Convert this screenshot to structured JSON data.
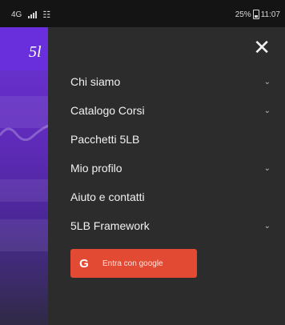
{
  "status_bar": {
    "network": "4G",
    "battery": "25%",
    "time": "11:07"
  },
  "background_page": {
    "logo": "5l"
  },
  "drawer": {
    "close_icon": "close-icon",
    "menu": [
      {
        "label": "Chi siamo",
        "has_submenu": true
      },
      {
        "label": "Catalogo Corsi",
        "has_submenu": true
      },
      {
        "label": "Pacchetti 5LB",
        "has_submenu": false
      },
      {
        "label": "Mio profilo",
        "has_submenu": true
      },
      {
        "label": "Aiuto e contatti",
        "has_submenu": false
      },
      {
        "label": "5LB Framework",
        "has_submenu": true
      }
    ],
    "google_button": {
      "icon": "G",
      "label": "Entra con google"
    }
  },
  "colors": {
    "drawer_bg": "#2c2c2c",
    "accent_purple": "#6a2fdc",
    "google_red": "#e24a34"
  }
}
